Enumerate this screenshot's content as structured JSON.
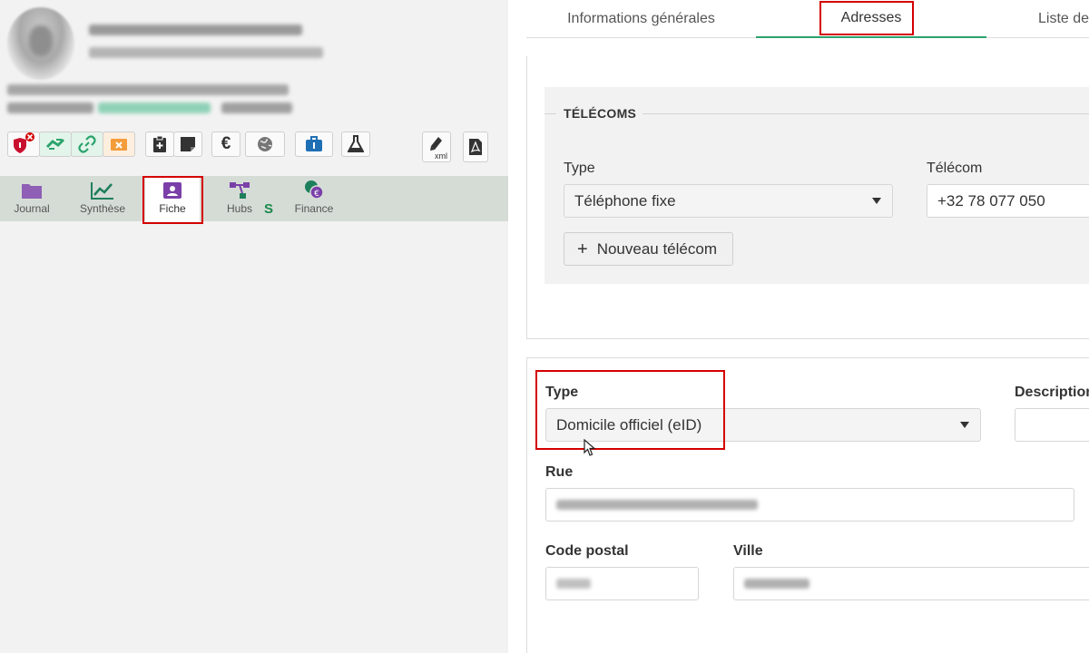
{
  "toolbar": {
    "icons": [
      "shield-alert-icon",
      "transfer-icon",
      "link-icon",
      "email-blocked-icon",
      "clipboard-plus-icon",
      "sticky-note-icon",
      "euro-icon",
      "globe-icon",
      "briefcase-icon",
      "flask-icon",
      "pen-xml-icon",
      "pdf-icon"
    ],
    "xml_label": "xml",
    "euro_symbol": "€"
  },
  "nav": {
    "items": [
      {
        "label": "Journal",
        "icon": "folder-icon"
      },
      {
        "label": "Synthèse",
        "icon": "chart-line-icon"
      },
      {
        "label": "Fiche",
        "icon": "id-card-icon"
      },
      {
        "label": "Hubs",
        "icon": "hub-icon"
      },
      {
        "label": "Finance",
        "icon": "finance-icon"
      }
    ],
    "hubs_badge": "S",
    "active": "Fiche"
  },
  "tabs": {
    "items": [
      "Informations générales",
      "Adresses",
      "Liste de"
    ],
    "active": "Adresses"
  },
  "telecoms": {
    "title": "TÉLÉCOMS",
    "type_label": "Type",
    "type_value": "Téléphone fixe",
    "telecom_label": "Télécom",
    "telecom_value": "+32 78 077 050",
    "new_button": "Nouveau télécom",
    "plus": "+"
  },
  "address": {
    "type_label": "Type",
    "type_value": "Domicile officiel (eID)",
    "description_label": "Description",
    "street_label": "Rue",
    "postal_label": "Code postal",
    "city_label": "Ville"
  },
  "colors": {
    "accent_green": "#2ba36d",
    "highlight_red": "#d40000",
    "nav_bg": "#d5dcd6"
  }
}
